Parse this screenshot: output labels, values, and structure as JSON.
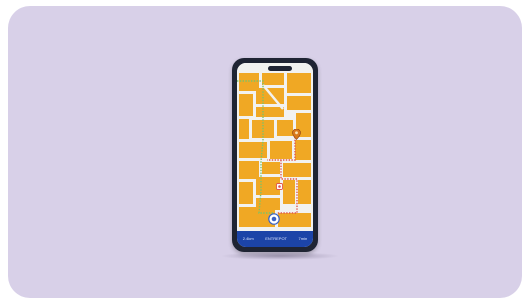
{
  "navigation_bar": {
    "distance": "2.4km",
    "status": "ENTREPOT",
    "time": "7min"
  },
  "colors": {
    "card_background": "#d8d0e8",
    "map_blocks": "#f0a824",
    "phone_body": "#1f2433",
    "bottom_bar": "#1c44a8",
    "route_green": "#7ac36a",
    "route_red": "#e0564f"
  },
  "icons": {
    "destination_pin": "orange-map-pin-icon",
    "waypoint_marker": "red-location-marker-icon",
    "current_location": "blue-location-dot-icon"
  }
}
